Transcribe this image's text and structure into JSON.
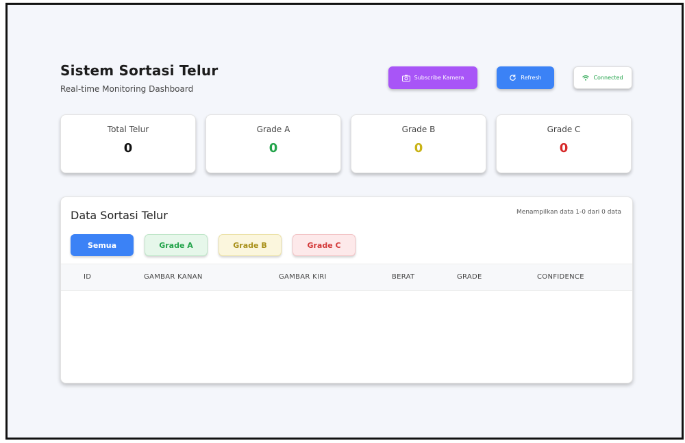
{
  "header": {
    "title": "Sistem Sortasi Telur",
    "subtitle": "Real-time Monitoring Dashboard"
  },
  "actions": {
    "subscribe_label": "Subscribe Kamera",
    "refresh_label": "Refresh",
    "connection_label": "Connected",
    "icons": [
      "camera-icon",
      "refresh-icon",
      "wifi-icon"
    ]
  },
  "stats": [
    {
      "label": "Total Telur",
      "value": "0",
      "color": "#111111"
    },
    {
      "label": "Grade A",
      "value": "0",
      "color": "#22a34a"
    },
    {
      "label": "Grade B",
      "value": "0",
      "color": "#c9b316"
    },
    {
      "label": "Grade C",
      "value": "0",
      "color": "#d62828"
    }
  ],
  "table": {
    "title": "Data Sortasi Telur",
    "info": "Menampilkan data 1-0 dari 0 data",
    "filters": [
      "Semua",
      "Grade A",
      "Grade B",
      "Grade C"
    ],
    "columns": [
      "ID",
      "GAMBAR KANAN",
      "GAMBAR KIRI",
      "BERAT",
      "GRADE",
      "CONFIDENCE"
    ],
    "rows": []
  }
}
